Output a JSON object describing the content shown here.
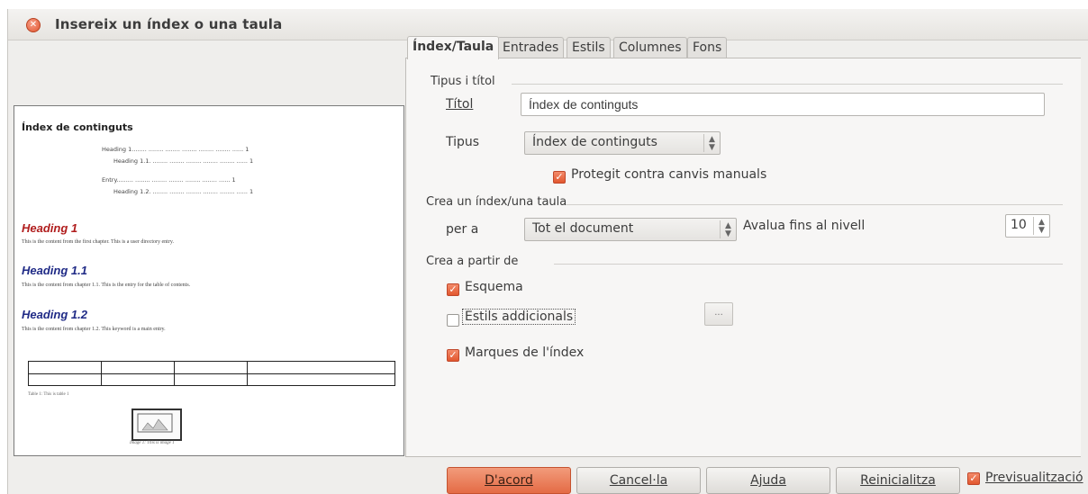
{
  "window": {
    "title": "Insereix un índex o una taula"
  },
  "preview": {
    "doc_title": "Índex de continguts",
    "toc": [
      {
        "text": "Heading 1........ ........ ........ ........ ........ ........ ...... 1"
      },
      {
        "text": "Heading 1.1. ........ ........ ........ ........ ........ ...... 1"
      },
      {
        "text": "Entry......... ........ ........ ........ ........ ........ ...... 1"
      },
      {
        "text": "Heading 1.2. ........ ........ ........ ........ ........ ...... 1"
      }
    ],
    "sections": [
      {
        "heading": "Heading 1",
        "body": "This is the content from the first chapter. This is a user directory entry.",
        "color": "#b01c1c"
      },
      {
        "heading": "Heading 1.1",
        "body": "This is the content from chapter 1.1. This is the entry for the table of contents.",
        "color": "#1f2a86"
      },
      {
        "heading": "Heading 1.2",
        "body": "This is the content from chapter 1.2. This keyword is a main entry.",
        "color": "#1f2a86"
      }
    ],
    "table_caption": "Table 1: This is table 1",
    "image_caption": "Image 1: This is image 1"
  },
  "tabs": [
    {
      "label": "Índex/Taula",
      "active": true
    },
    {
      "label": "Entrades",
      "active": false
    },
    {
      "label": "Estils",
      "active": false
    },
    {
      "label": "Columnes",
      "active": false
    },
    {
      "label": "Fons",
      "active": false
    }
  ],
  "type_title": {
    "heading": "Tipus i títol",
    "title_label": "Títol",
    "title_value": "Índex de continguts",
    "type_label": "Tipus",
    "type_value": "Índex de continguts",
    "protect_label": "Protegit contra canvis manuals",
    "protect_checked": true
  },
  "create_index": {
    "heading": "Crea un índex/una taula",
    "for_label": "per a",
    "for_value": "Tot el document",
    "level_label": "Avalua fins al nivell",
    "level_value": "10"
  },
  "create_from": {
    "heading": "Crea a partir de",
    "outline_label": "Esquema",
    "outline_checked": true,
    "styles_label": "Estils addicionals",
    "styles_checked": false,
    "styles_button": "...",
    "marks_label": "Marques de l'índex",
    "marks_checked": true
  },
  "buttons": {
    "ok": "D'acord",
    "cancel": "Cancel·la",
    "help": "Ajuda",
    "reset": "Reinicialitza",
    "preview_label": "Previsualització",
    "preview_checked": true
  },
  "colors": {
    "accent": "#e46b45"
  }
}
